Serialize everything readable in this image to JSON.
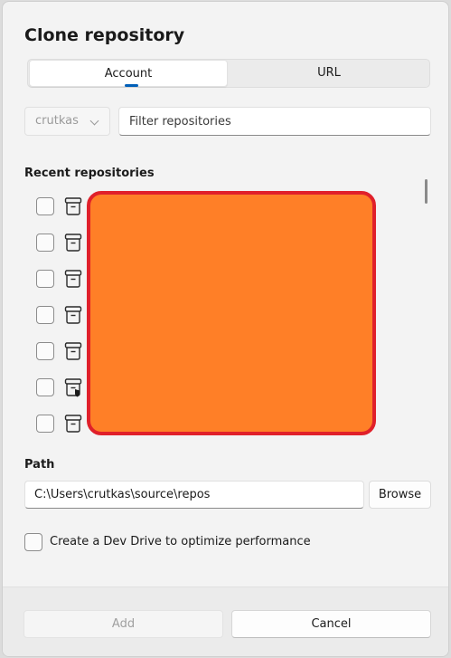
{
  "dialog": {
    "title": "Clone repository"
  },
  "tabs": {
    "account": "Account",
    "url": "URL"
  },
  "account": {
    "selected": "crutkas"
  },
  "filter": {
    "placeholder": "Filter repositories",
    "value": ""
  },
  "recent": {
    "label": "Recent repositories",
    "rows": [
      {
        "icon": "repository-icon"
      },
      {
        "icon": "repository-icon"
      },
      {
        "icon": "repository-icon"
      },
      {
        "icon": "repository-icon"
      },
      {
        "icon": "repository-icon"
      },
      {
        "icon": "private-repository-icon"
      },
      {
        "icon": "repository-icon"
      }
    ]
  },
  "path": {
    "label": "Path",
    "value": "C:\\Users\\crutkas\\source\\repos",
    "browse": "Browse"
  },
  "devdrive": {
    "label": "Create a Dev Drive to optimize performance"
  },
  "footer": {
    "add": "Add",
    "cancel": "Cancel"
  },
  "colors": {
    "accent": "#005fb8",
    "redaction_fill": "#ff7f27",
    "redaction_border": "#e0202a"
  }
}
